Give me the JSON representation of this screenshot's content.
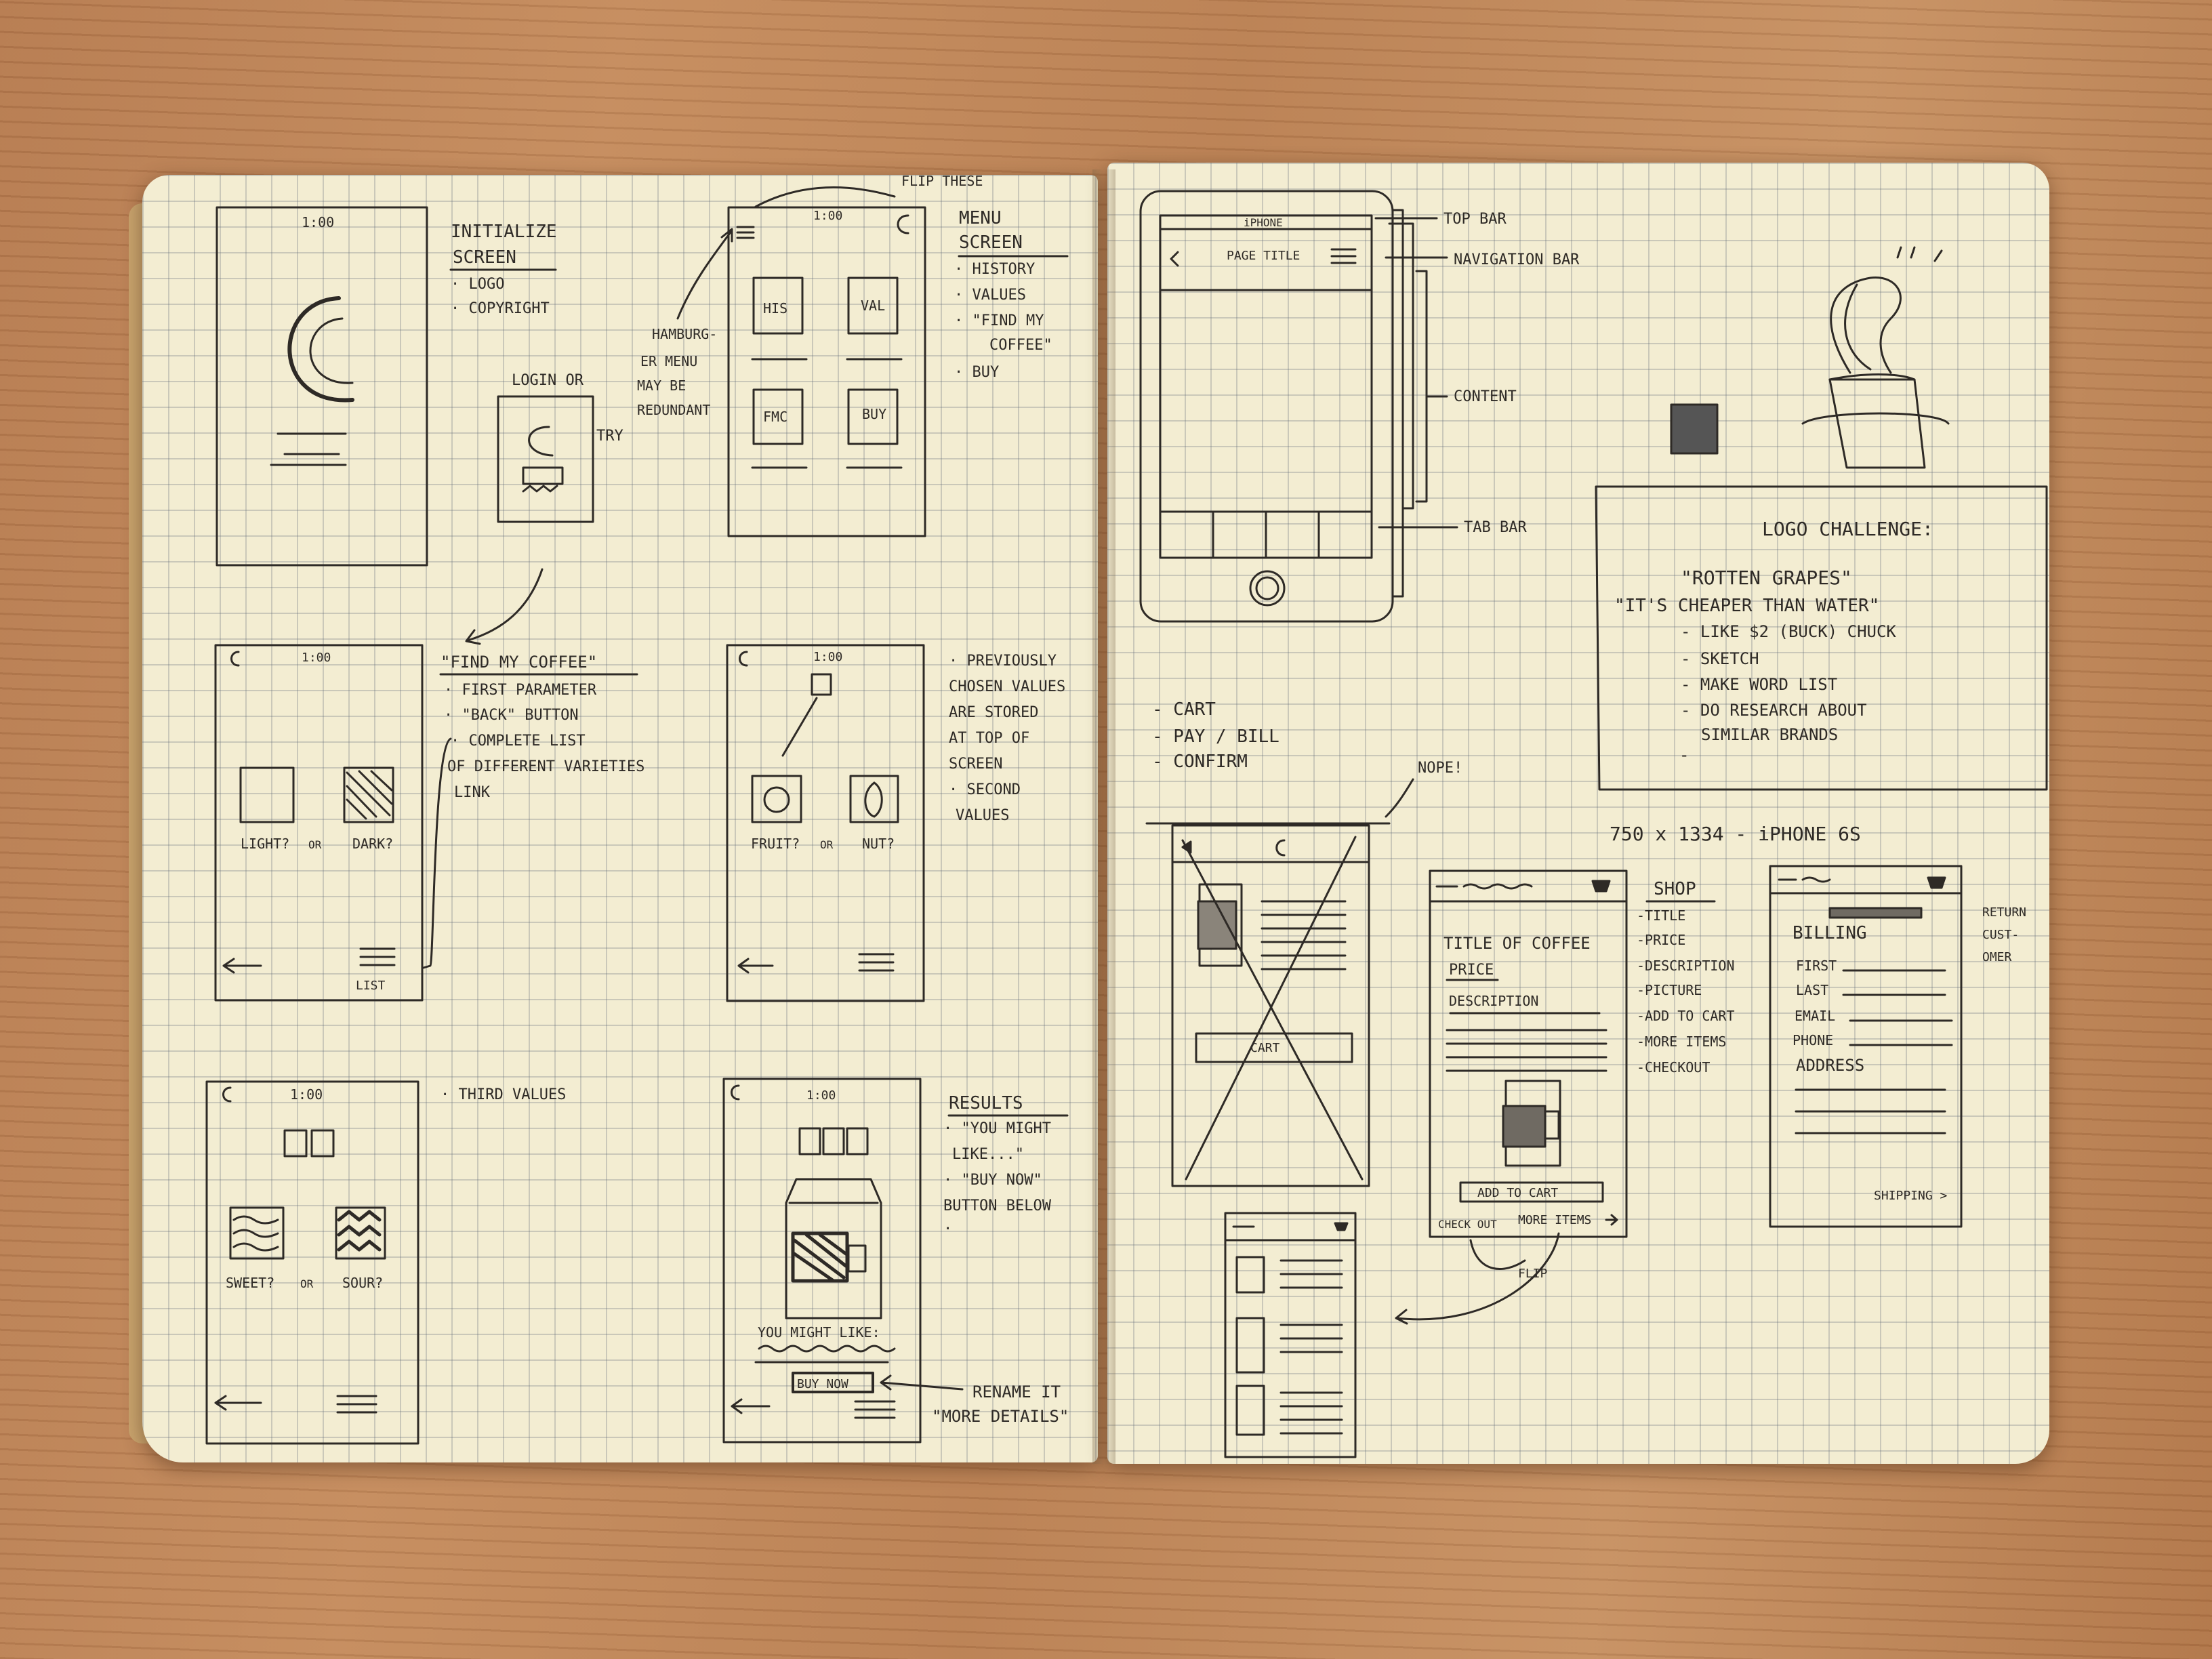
{
  "left_page": {
    "init_screen": {
      "time": "1:00",
      "notes": [
        "INITIALIZE",
        "SCREEN",
        "· LOGO",
        "· COPYRIGHT"
      ],
      "login_note": [
        "LOGIN OR",
        "TRY"
      ]
    },
    "hamburger_note": [
      "HAMBURG-",
      "ER MENU",
      "MAY BE",
      "REDUNDANT"
    ],
    "flip_note": "FLIP THESE",
    "menu_screen": {
      "time": "1:00",
      "tiles": [
        "HIS",
        "VAL",
        "FMC",
        "BUY"
      ],
      "notes": [
        "MENU",
        "SCREEN",
        "· HISTORY",
        "· VALUES",
        "· \"FIND MY",
        "COFFEE\"",
        "· BUY"
      ]
    },
    "find_screen": {
      "time": "1:00",
      "options": [
        "LIGHT?",
        "OR",
        "DARK?"
      ],
      "list_label": "LIST",
      "notes": [
        "\"FIND MY COFFEE\"",
        "· FIRST PARAMETER",
        "· \"BACK\" BUTTON",
        "· COMPLETE LIST",
        "OF DIFFERENT VARIETIES",
        "LINK"
      ]
    },
    "second_screen": {
      "time": "1:00",
      "options": [
        "FRUIT?",
        "OR",
        "NUT?"
      ],
      "notes": [
        "· PREVIOUSLY",
        "CHOSEN VALUES",
        "ARE STORED",
        "AT TOP OF",
        "SCREEN",
        "· SECOND",
        "VALUES"
      ]
    },
    "third_screen": {
      "time": "1:00",
      "options": [
        "SWEET?",
        "OR",
        "SOUR?"
      ],
      "notes": [
        "· THIRD VALUES"
      ]
    },
    "results_screen": {
      "time": "1:00",
      "you_might_like": "YOU MIGHT LIKE:",
      "buy_now": "BUY NOW",
      "notes": [
        "RESULTS",
        "· \"YOU MIGHT",
        "LIKE...\"",
        "· \"BUY NOW\"",
        "BUTTON BELOW",
        "·"
      ],
      "rename_note": [
        "RENAME IT",
        "\"MORE DETAILS\""
      ]
    }
  },
  "right_page": {
    "phone": {
      "status": "iPHONE",
      "page_title": "PAGE TITLE"
    },
    "phone_labels": [
      "TOP BAR",
      "NAVIGATION BAR",
      "CONTENT",
      "TAB BAR"
    ],
    "logo_challenge": [
      "LOGO CHALLENGE:",
      "\"ROTTEN GRAPES\"",
      "\"IT'S CHEAPER THAN WATER\"",
      "- LIKE $2 (BUCK) CHUCK",
      "- SKETCH",
      "- MAKE WORD LIST",
      "- DO RESEARCH ABOUT",
      "SIMILAR BRANDS",
      "-"
    ],
    "cart_list": [
      "- CART",
      "- PAY / BILL",
      "- CONFIRM"
    ],
    "nope": "NOPE!",
    "dims": "750 x 1334 - iPHONE 6S",
    "crossed_screen": {
      "cart": "CART"
    },
    "product_screen": {
      "title": "TITLE OF COFFEE",
      "price": "PRICE",
      "description": "DESCRIPTION",
      "add_to_cart": "ADD TO CART",
      "checkout": "CHECK OUT",
      "more_items": "MORE ITEMS",
      "flip": "FLIP"
    },
    "shop_notes": [
      "SHOP",
      "-TITLE",
      "-PRICE",
      "-DESCRIPTION",
      "-PICTURE",
      "-ADD TO CART",
      "-MORE ITEMS",
      "-CHECKOUT"
    ],
    "billing_screen": {
      "fields": [
        "BILLING",
        "FIRST",
        "LAST",
        "EMAIL",
        "PHONE",
        "ADDRESS"
      ],
      "shipping": "SHIPPING >"
    },
    "return_note": [
      "RETURN",
      "CUST-",
      "OMER"
    ]
  },
  "colors": {
    "paper": "#f3edd2",
    "ink": "#2e2a26",
    "desk": "#c48b5d"
  }
}
